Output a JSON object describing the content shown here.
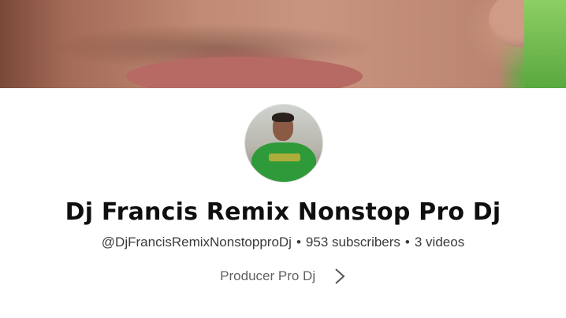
{
  "channel": {
    "name": "Dj Francis Remix Nonstop Pro Dj",
    "handle": "@DjFrancisRemixNonstopproDj",
    "separator": "•",
    "subscribers": "953 subscribers",
    "videos": "3 videos",
    "description": "Producer Pro Dj"
  },
  "icons": {
    "more": "chevron-right-icon"
  }
}
